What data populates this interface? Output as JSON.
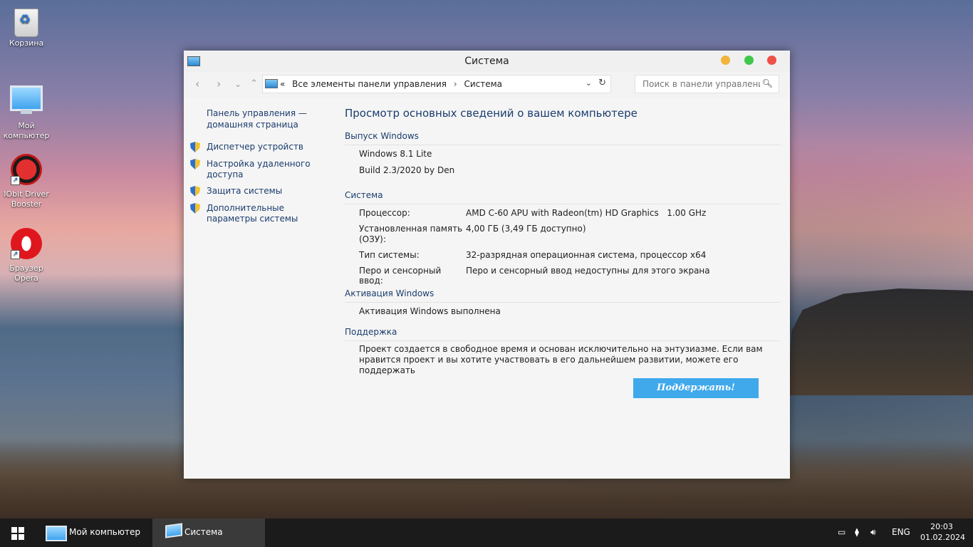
{
  "desktop": {
    "icons": [
      {
        "label": "Корзина"
      },
      {
        "label": "Мой компьютер"
      },
      {
        "label": "IObit Driver Booster"
      },
      {
        "label": "Браузер Opera"
      }
    ]
  },
  "window": {
    "title": "Система",
    "address": {
      "root_sep": "«",
      "crumb1": "Все элементы панели управления",
      "sep": "›",
      "crumb2": "Система"
    },
    "search_placeholder": "Поиск в панели управления",
    "sidebar": {
      "home": "Панель управления — домашняя страница",
      "links": [
        {
          "label": "Диспетчер устройств"
        },
        {
          "label": "Настройка удаленного доступа"
        },
        {
          "label": "Защита системы"
        },
        {
          "label": "Дополнительные параметры системы"
        }
      ]
    },
    "main": {
      "heading": "Просмотр основных сведений о вашем компьютере",
      "edition": {
        "header": "Выпуск Windows",
        "name": "Windows 8.1 Lite",
        "build": "Build 2.3/2020 by Den"
      },
      "system": {
        "header": "Система",
        "rows": [
          {
            "label": "Процессор:",
            "value": "AMD C-60 APU with Radeon(tm) HD Graphics   1.00 GHz"
          },
          {
            "label": "Установленная память (ОЗУ):",
            "value": "4,00 ГБ (3,49 ГБ доступно)"
          },
          {
            "label": "Тип системы:",
            "value": "32-разрядная операционная система, процессор x64"
          },
          {
            "label": "Перо и сенсорный ввод:",
            "value": "Перо и сенсорный ввод недоступны для этого экрана"
          }
        ]
      },
      "activation": {
        "header": "Активация Windows",
        "status": "Активация Windows выполнена"
      },
      "support": {
        "header": "Поддержка",
        "text": "Проект создается в свободное время и основан исключительно на энтузиазме. Если вам нравится проект и вы хотите участвовать в его дальнейшем развитии, можете его поддержать",
        "button": "Поддержать!"
      }
    }
  },
  "taskbar": {
    "items": [
      {
        "label": "Мой компьютер"
      },
      {
        "label": "Система"
      }
    ],
    "lang": "ENG",
    "time": "20:03",
    "date": "01.02.2024"
  },
  "colors": {
    "link": "#1a3c6e",
    "donate": "#3fa9ec",
    "close": "#ef5048",
    "minimize": "#f2b43a",
    "maximize": "#3ec84a"
  }
}
